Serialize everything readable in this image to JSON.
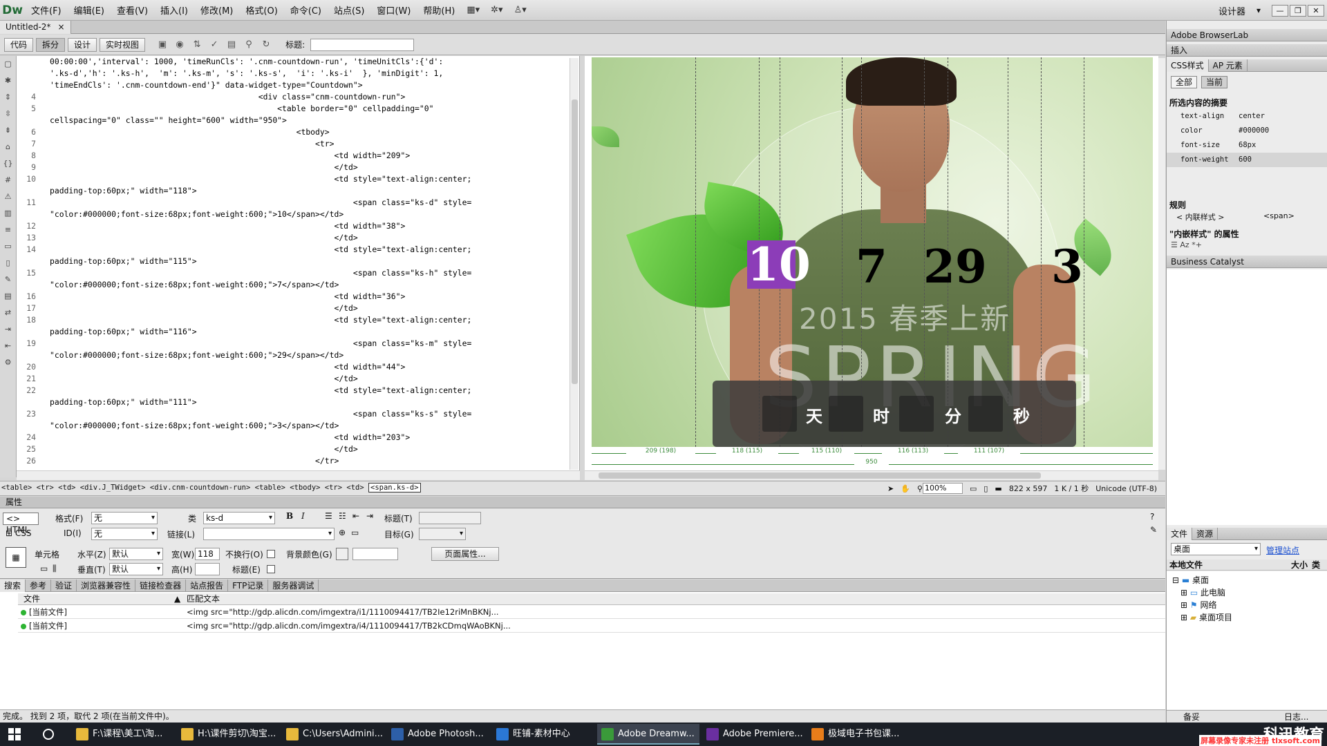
{
  "app": {
    "logo": "Dw",
    "workspace": "设计器"
  },
  "menu": [
    "文件(F)",
    "编辑(E)",
    "查看(V)",
    "插入(I)",
    "修改(M)",
    "格式(O)",
    "命令(C)",
    "站点(S)",
    "窗口(W)",
    "帮助(H)"
  ],
  "document_tab": {
    "name": "Untitled-2*",
    "close": "×"
  },
  "view_buttons": {
    "code": "代码",
    "split": "拆分",
    "design": "设计",
    "live": "实时视图"
  },
  "title_label": "标题:",
  "code_lines": [
    {
      "n": "",
      "t": "00:00:00','interval': 1000, 'timeRunCls': '.cnm-countdown-run', 'timeUnitCls':{'d':"
    },
    {
      "n": "",
      "t": "'.ks-d','h': '.ks-h',  'm': '.ks-m', 's': '.ks-s',  'i': '.ks-i'  }, 'minDigit': 1,"
    },
    {
      "n": "",
      "t": "'timeEndCls': '.cnm-countdown-end'}\" data-widget-type=\"Countdown\">"
    },
    {
      "n": "4",
      "t": "                                            <div class=\"cnm-countdown-run\">"
    },
    {
      "n": "5",
      "t": "                                                <table border=\"0\" cellpadding=\"0\""
    },
    {
      "n": "",
      "t": "cellspacing=\"0\" class=\"\" height=\"600\" width=\"950\">"
    },
    {
      "n": "6",
      "t": "                                                    <tbody>"
    },
    {
      "n": "7",
      "t": "                                                        <tr>"
    },
    {
      "n": "8",
      "t": "                                                            <td width=\"209\">"
    },
    {
      "n": "9",
      "t": "                                                            </td>"
    },
    {
      "n": "10",
      "t": "                                                            <td style=\"text-align:center;"
    },
    {
      "n": "",
      "t": "padding-top:60px;\" width=\"118\">"
    },
    {
      "n": "11",
      "t": "                                                                <span class=\"ks-d\" style="
    },
    {
      "n": "",
      "t": "\"color:#000000;font-size:68px;font-weight:600;\">10</span></td>"
    },
    {
      "n": "12",
      "t": "                                                            <td width=\"38\">"
    },
    {
      "n": "13",
      "t": "                                                            </td>"
    },
    {
      "n": "14",
      "t": "                                                            <td style=\"text-align:center;"
    },
    {
      "n": "",
      "t": "padding-top:60px;\" width=\"115\">"
    },
    {
      "n": "15",
      "t": "                                                                <span class=\"ks-h\" style="
    },
    {
      "n": "",
      "t": "\"color:#000000;font-size:68px;font-weight:600;\">7</span></td>"
    },
    {
      "n": "16",
      "t": "                                                            <td width=\"36\">"
    },
    {
      "n": "17",
      "t": "                                                            </td>"
    },
    {
      "n": "18",
      "t": "                                                            <td style=\"text-align:center;"
    },
    {
      "n": "",
      "t": "padding-top:60px;\" width=\"116\">"
    },
    {
      "n": "19",
      "t": "                                                                <span class=\"ks-m\" style="
    },
    {
      "n": "",
      "t": "\"color:#000000;font-size:68px;font-weight:600;\">29</span></td>"
    },
    {
      "n": "20",
      "t": "                                                            <td width=\"44\">"
    },
    {
      "n": "21",
      "t": "                                                            </td>"
    },
    {
      "n": "22",
      "t": "                                                            <td style=\"text-align:center;"
    },
    {
      "n": "",
      "t": "padding-top:60px;\" width=\"111\">"
    },
    {
      "n": "23",
      "t": "                                                                <span class=\"ks-s\" style="
    },
    {
      "n": "",
      "t": "\"color:#000000;font-size:68px;font-weight:600;\">3</span></td>"
    },
    {
      "n": "24",
      "t": "                                                            <td width=\"203\">"
    },
    {
      "n": "25",
      "t": "                                                            </td>"
    },
    {
      "n": "26",
      "t": "                                                        </tr>"
    }
  ],
  "design": {
    "countdown": {
      "d": "10",
      "h": "7",
      "m": "29",
      "s": "3"
    },
    "subtitle": "2015 春季上新",
    "big_text": "SPRING",
    "units": {
      "d": "天",
      "h": "时",
      "m": "分",
      "s": "秒"
    },
    "width_labels": [
      "209 (198)",
      "118 (115)",
      "115 (110)",
      "116 (113)",
      "111 (107)"
    ],
    "total_width": "950"
  },
  "tag_selector": {
    "path": "<table> <tr> <td> <div.J_TWidget> <div.cnm-countdown-run> <table> <tbody> <tr> <td>",
    "current": "<span.ks-d>"
  },
  "status": {
    "zoom": "100%",
    "size": "822 x 597",
    "download": "1 K / 1 秒",
    "encoding": "Unicode (UTF-8)"
  },
  "properties": {
    "panel_title": "属性",
    "html_btn": "HTML",
    "css_btn": "CSS",
    "format_label": "格式(F)",
    "format_value": "无",
    "class_label": "类",
    "class_value": "ks-d",
    "id_label": "ID(I)",
    "id_value": "无",
    "link_label": "链接(L)",
    "heading_label": "标题(T)",
    "target_label": "目标(G)",
    "cell_label": "单元格",
    "horz_label": "水平(Z)",
    "horz_value": "默认",
    "vert_label": "垂直(T)",
    "vert_value": "默认",
    "width_label": "宽(W)",
    "width_value": "118",
    "height_label": "高(H)",
    "nowrap_label": "不换行(O)",
    "header_label": "标题(E)",
    "bg_label": "背景颜色(G)",
    "page_props": "页面属性..."
  },
  "results_tabs": [
    "搜索",
    "参考",
    "验证",
    "浏览器兼容性",
    "链接检查器",
    "站点报告",
    "FTP记录",
    "服务器调试"
  ],
  "results_head": {
    "file": "文件",
    "match": "匹配文本"
  },
  "results_rows": [
    {
      "file": "[当前文件]",
      "match": "<img src=\"http://gdp.alicdn.com/imgextra/i1/1110094417/TB2Ie12riMnBKNj..."
    },
    {
      "file": "[当前文件]",
      "match": "<img src=\"http://gdp.alicdn.com/imgextra/i4/1110094417/TB2kCDmqWAoBKNj..."
    }
  ],
  "results_status": "完成。  找到 2 项，取代 2 项(在当前文件中)。",
  "right_panel": {
    "browserlab": "Adobe BrowserLab",
    "insert": "插入",
    "css_tab": "CSS样式",
    "ap_tab": "AP 元素",
    "all_btn": "全部",
    "current_btn": "当前",
    "summary_title": "所选内容的摘要",
    "props": [
      {
        "k": "text-align",
        "v": "center"
      },
      {
        "k": "color",
        "v": "#000000"
      },
      {
        "k": "font-size",
        "v": "68px"
      },
      {
        "k": "font-weight",
        "v": "600"
      }
    ],
    "rules_title": "规则",
    "rule_inline": "< 内联样式 >",
    "rule_span": "<span>",
    "inline_props_title": "\"内嵌样式\" 的属性",
    "business_catalyst": "Business Catalyst",
    "files_tab": "文件",
    "assets_tab": "资源",
    "site_select": "桌面",
    "manage_sites": "管理站点",
    "local_files": "本地文件",
    "size_col": "大小",
    "type_col": "类型",
    "tree": [
      "桌面",
      "此电脑",
      "网络",
      "桌面项目"
    ],
    "bottom_left": "备妥",
    "bottom_right": "日志..."
  },
  "taskbar": [
    {
      "label": "F:\\课程\\美工\\淘...",
      "color": "#e8b93c"
    },
    {
      "label": "H:\\课件剪切\\淘宝...",
      "color": "#e8b93c"
    },
    {
      "label": "C:\\Users\\Admini...",
      "color": "#e8b93c"
    },
    {
      "label": "Adobe Photosh...",
      "color": "#2d5fa8"
    },
    {
      "label": "旺铺-素材中心",
      "color": "#2b78d6"
    },
    {
      "label": "Adobe Dreamw...",
      "color": "#3a9a3a"
    },
    {
      "label": "Adobe Premiere...",
      "color": "#6a2fa0"
    },
    {
      "label": "极域电子书包课...",
      "color": "#e87d1a"
    }
  ],
  "watermark": {
    "brand": "科迅教育",
    "note": "屏幕录像专家未注册 tlxsoft.com"
  }
}
